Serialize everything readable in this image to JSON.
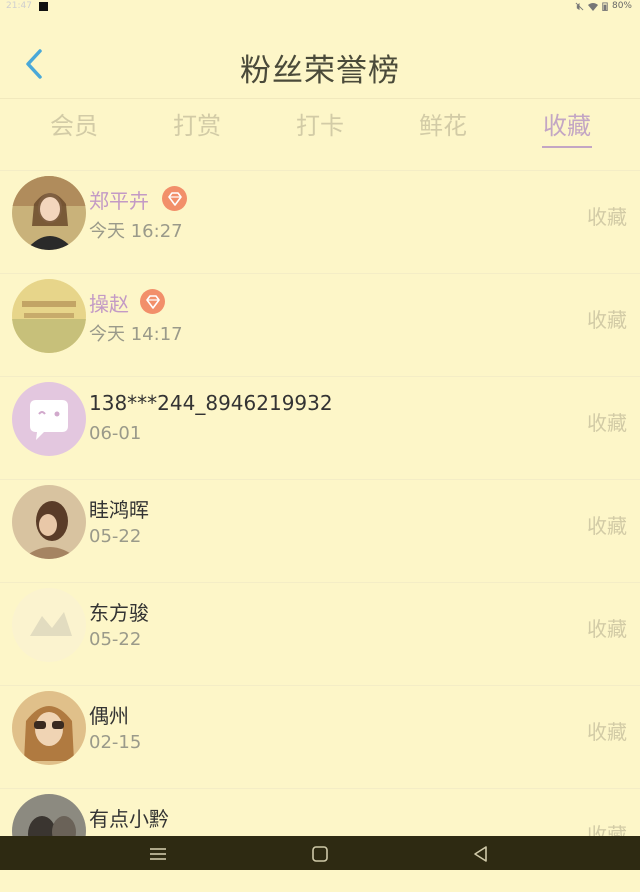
{
  "status_bar": {
    "time": "21:47",
    "battery": "80%"
  },
  "header": {
    "title": "粉丝荣誉榜"
  },
  "tabs": [
    {
      "label": "会员",
      "active": false
    },
    {
      "label": "打赏",
      "active": false
    },
    {
      "label": "打卡",
      "active": false
    },
    {
      "label": "鲜花",
      "active": false
    },
    {
      "label": "收藏",
      "active": true
    }
  ],
  "fans": [
    {
      "name": "郑平卉",
      "time": "今天 16:27",
      "vip": true,
      "action": "收藏"
    },
    {
      "name": "操赵",
      "time": "今天 14:17",
      "vip": true,
      "action": "收藏"
    },
    {
      "name": "138***244_8946219932",
      "time": "06-01",
      "vip": false,
      "action": "收藏"
    },
    {
      "name": "眭鸿晖",
      "time": "05-22",
      "vip": false,
      "action": "收藏"
    },
    {
      "name": "东方骏",
      "time": "05-22",
      "vip": false,
      "action": "收藏"
    },
    {
      "name": "偶州",
      "time": "02-15",
      "vip": false,
      "action": "收藏"
    },
    {
      "name": "有点小黔",
      "time": "",
      "vip": false,
      "action": "收藏"
    }
  ],
  "colors": {
    "background": "#fdf6c8",
    "accent": "#c3a6c4",
    "back_arrow": "#4aa8d8",
    "badge": "#f28f6a",
    "nav_bar": "#2e2a12"
  }
}
